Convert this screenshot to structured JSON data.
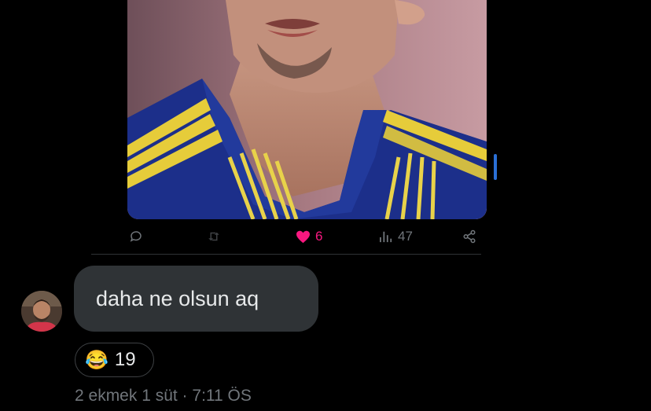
{
  "post": {
    "image_icon": "football-player-photo",
    "actions": {
      "reply_icon": "reply-icon",
      "repost_icon": "repost-icon",
      "like_icon": "heart-icon",
      "like_count": "6",
      "views_icon": "views-icon",
      "views_count": "47",
      "share_icon": "share-icon"
    },
    "colors": {
      "like": "#f91880",
      "muted": "#71767b",
      "accent": "#2a6fd6"
    }
  },
  "message": {
    "avatar_icon": "user-avatar",
    "text": "daha ne olsun aq",
    "reaction": {
      "emoji": "😂",
      "count": "19"
    },
    "meta": "2 ekmek 1 süt · 7:11 ÖS",
    "bubble_color": "#2f3336"
  }
}
